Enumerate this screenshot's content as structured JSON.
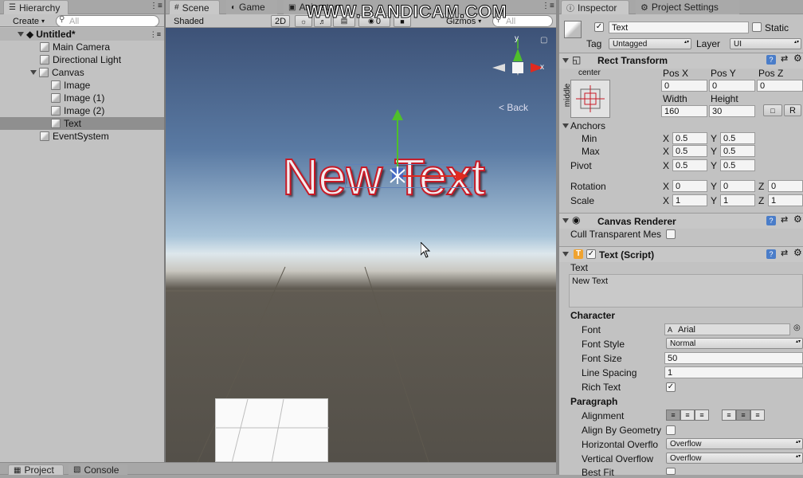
{
  "hierarchy": {
    "tab_label": "Hierarchy",
    "create_label": "Create",
    "search_placeholder": "All",
    "scene_name": "Untitled*",
    "items": [
      {
        "label": "Main Camera"
      },
      {
        "label": "Directional Light"
      },
      {
        "label": "Canvas"
      },
      {
        "label": "Image"
      },
      {
        "label": "Image (1)"
      },
      {
        "label": "Image (2)"
      },
      {
        "label": "Text"
      },
      {
        "label": "EventSystem"
      }
    ]
  },
  "scene": {
    "tabs": [
      "Scene",
      "Game",
      "Animator"
    ],
    "shading_mode": "Shaded",
    "mode_2d": "2D",
    "gizmos_label": "Gizmos",
    "search_placeholder": "All",
    "count_badge": "0",
    "back_label": "Back",
    "canvas_text": "New Text",
    "watermark": "WWW.BANDICAM.COM"
  },
  "bottom_tabs": [
    "Project",
    "Console"
  ],
  "inspector": {
    "tabs": [
      "Inspector",
      "Project Settings"
    ],
    "object_name": "Text",
    "static_label": "Static",
    "tag_label": "Tag",
    "tag_value": "Untagged",
    "layer_label": "Layer",
    "layer_value": "UI",
    "rect_transform": {
      "title": "Rect Transform",
      "anchor_h": "center",
      "anchor_v": "middle",
      "pos_x_label": "Pos X",
      "pos_y_label": "Pos Y",
      "pos_z_label": "Pos Z",
      "pos_x": "0",
      "pos_y": "0",
      "pos_z": "0",
      "width_label": "Width",
      "height_label": "Height",
      "width": "160",
      "height": "30",
      "r_button": "R",
      "anchors_label": "Anchors",
      "min_label": "Min",
      "max_label": "Max",
      "pivot_label": "Pivot",
      "rotation_label": "Rotation",
      "scale_label": "Scale",
      "x": "X",
      "y": "Y",
      "z": "Z",
      "min_x": "0.5",
      "min_y": "0.5",
      "max_x": "0.5",
      "max_y": "0.5",
      "pivot_x": "0.5",
      "pivot_y": "0.5",
      "rot_x": "0",
      "rot_y": "0",
      "rot_z": "0",
      "scale_x": "1",
      "scale_y": "1",
      "scale_z": "1"
    },
    "canvas_renderer": {
      "title": "Canvas Renderer",
      "cull_label": "Cull Transparent Mes"
    },
    "text_script": {
      "title": "Text (Script)",
      "text_label": "Text",
      "text_value": "New Text",
      "character_label": "Character",
      "font_label": "Font",
      "font_value": "Arial",
      "font_style_label": "Font Style",
      "font_style_value": "Normal",
      "font_size_label": "Font Size",
      "font_size_value": "50",
      "line_spacing_label": "Line Spacing",
      "line_spacing_value": "1",
      "rich_text_label": "Rich Text",
      "paragraph_label": "Paragraph",
      "alignment_label": "Alignment",
      "align_geometry_label": "Align By Geometry",
      "h_overflow_label": "Horizontal Overflo",
      "h_overflow_value": "Overflow",
      "v_overflow_label": "Vertical Overflow",
      "v_overflow_value": "Overflow",
      "best_fit_label": "Best Fit"
    }
  },
  "colors": {
    "selection": "#8f8f8f",
    "sky_top": "#39517a",
    "ground": "#545049",
    "text_red": "#c81a26",
    "gizmo_green": "#4fbf2a",
    "gizmo_red": "#e02a1f"
  }
}
